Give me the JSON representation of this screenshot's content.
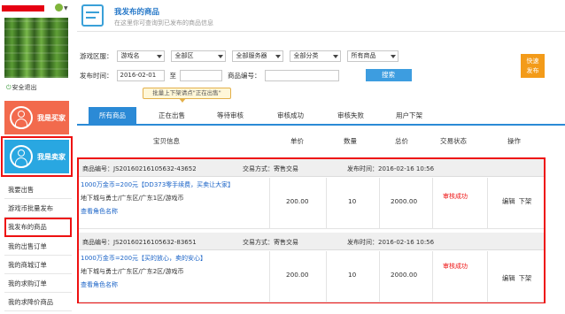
{
  "sidebar": {
    "logout_label": "安全退出",
    "roles": {
      "buyer_label": "我是买家",
      "seller_label": "我是卖家"
    },
    "menu": [
      "我要出售",
      "游戏币批量发布",
      "我发布的商品",
      "我的出售订单",
      "我的商城订单",
      "我的求购订单",
      "我的求降价商品"
    ]
  },
  "header": {
    "title": "我发布的商品",
    "subtitle": "在这里你可查询到已发布的商品信息"
  },
  "filters": {
    "region_label": "游戏区服：",
    "game_select": "游戏名",
    "area_select": "全部区",
    "server_select": "全部服务器",
    "category_select": "全部分类",
    "goods_select": "所有商品",
    "time_label": "发布时间：",
    "date_from": "2016-02-01",
    "to_label": "至",
    "date_to": "",
    "goods_no_label": "商品编号：",
    "goods_no_value": "",
    "search_label": "搜索",
    "quick_publish_label": "快速发布"
  },
  "tooltip": "批量上下架请点\"正在出售\"",
  "tabs": [
    "所有商品",
    "正在出售",
    "等待审核",
    "审核成功",
    "审核失败",
    "用户下架"
  ],
  "table": {
    "headers": [
      "宝贝信息",
      "单价",
      "数量",
      "总价",
      "交易状态",
      "操作"
    ]
  },
  "orders": [
    {
      "goods_no_label": "商品编号：",
      "goods_no": "JS20160216105632-43652",
      "trade_label": "交易方式：",
      "trade": "寄售交易",
      "time_label": "发布时间：",
      "time": "2016-02-16 10:56",
      "title": "1000万金币=200元【DD373零手续费，买卖让大家】",
      "desc": "地下城与勇士/广东区/广东1区/游戏币",
      "role_link": "查看角色名称",
      "price": "200.00",
      "qty": "10",
      "total": "2000.00",
      "status": "审核成功",
      "actions": [
        "编辑",
        "下架"
      ]
    },
    {
      "goods_no_label": "商品编号：",
      "goods_no": "JS20160216105632-83651",
      "trade_label": "交易方式：",
      "trade": "寄售交易",
      "time_label": "发布时间：",
      "time": "2016-02-16 10:56",
      "title": "1000万金币=200元【买的放心，卖的安心】",
      "desc": "地下城与勇士/广东区/广东2区/游戏币",
      "role_link": "查看角色名称",
      "price": "200.00",
      "qty": "10",
      "total": "2000.00",
      "status": "审核成功",
      "actions": [
        "编辑",
        "下架"
      ]
    }
  ],
  "colors": {
    "accent_blue": "#2b8ad6",
    "buyer_orange": "#f26a4d",
    "seller_blue": "#29a7e1",
    "highlight_red": "#ee1111",
    "quick_orange": "#f39b19"
  }
}
